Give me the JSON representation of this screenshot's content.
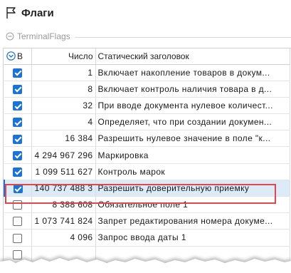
{
  "window": {
    "title": "Флаги",
    "flag_icon": "flag-outline-icon"
  },
  "group": {
    "label": "TerminalFlags",
    "icon": "collapse-circle-icon"
  },
  "colors": {
    "accent": "#1a73d8",
    "selected_row": "#dcebf7",
    "highlight": "#e0474c",
    "group_text": "#9a9a9a"
  },
  "grid": {
    "headers": {
      "check": "В",
      "number": "Число",
      "heading": "Статический заголовок"
    },
    "sort_icon": "sort-chevron-circle-icon",
    "rows": [
      {
        "checked": true,
        "number": "1",
        "heading": "Включает накопление товаров в докум..."
      },
      {
        "checked": true,
        "number": "8",
        "heading": "Включает контроль наличия товара в д..."
      },
      {
        "checked": true,
        "number": "32",
        "heading": "При вводе документа нулевое количест..."
      },
      {
        "checked": true,
        "number": "4",
        "heading": "Определяет, что при создании докумен..."
      },
      {
        "checked": true,
        "number": "16 384",
        "heading": "Разрешить нулевое значение в поле \"к..."
      },
      {
        "checked": true,
        "number": "4 294 967 296",
        "heading": "Маркировка"
      },
      {
        "checked": true,
        "number": "1 099 511 627",
        "heading": "Контроль марок"
      },
      {
        "checked": true,
        "number": "140 737 488 3",
        "heading": "Разрешить доверительную приемку",
        "selected": true
      },
      {
        "checked": false,
        "number": "8 388 608",
        "heading": "Обязательное поле 1"
      },
      {
        "checked": false,
        "number": "1 073 741 824",
        "heading": "Запрет редактирования номера докуме..."
      },
      {
        "checked": false,
        "number": "4 096",
        "heading": "Запрос ввода даты 1"
      },
      {
        "checked": false,
        "number": "",
        "heading": ""
      },
      {
        "checked": false,
        "number": "",
        "heading": ""
      }
    ]
  }
}
